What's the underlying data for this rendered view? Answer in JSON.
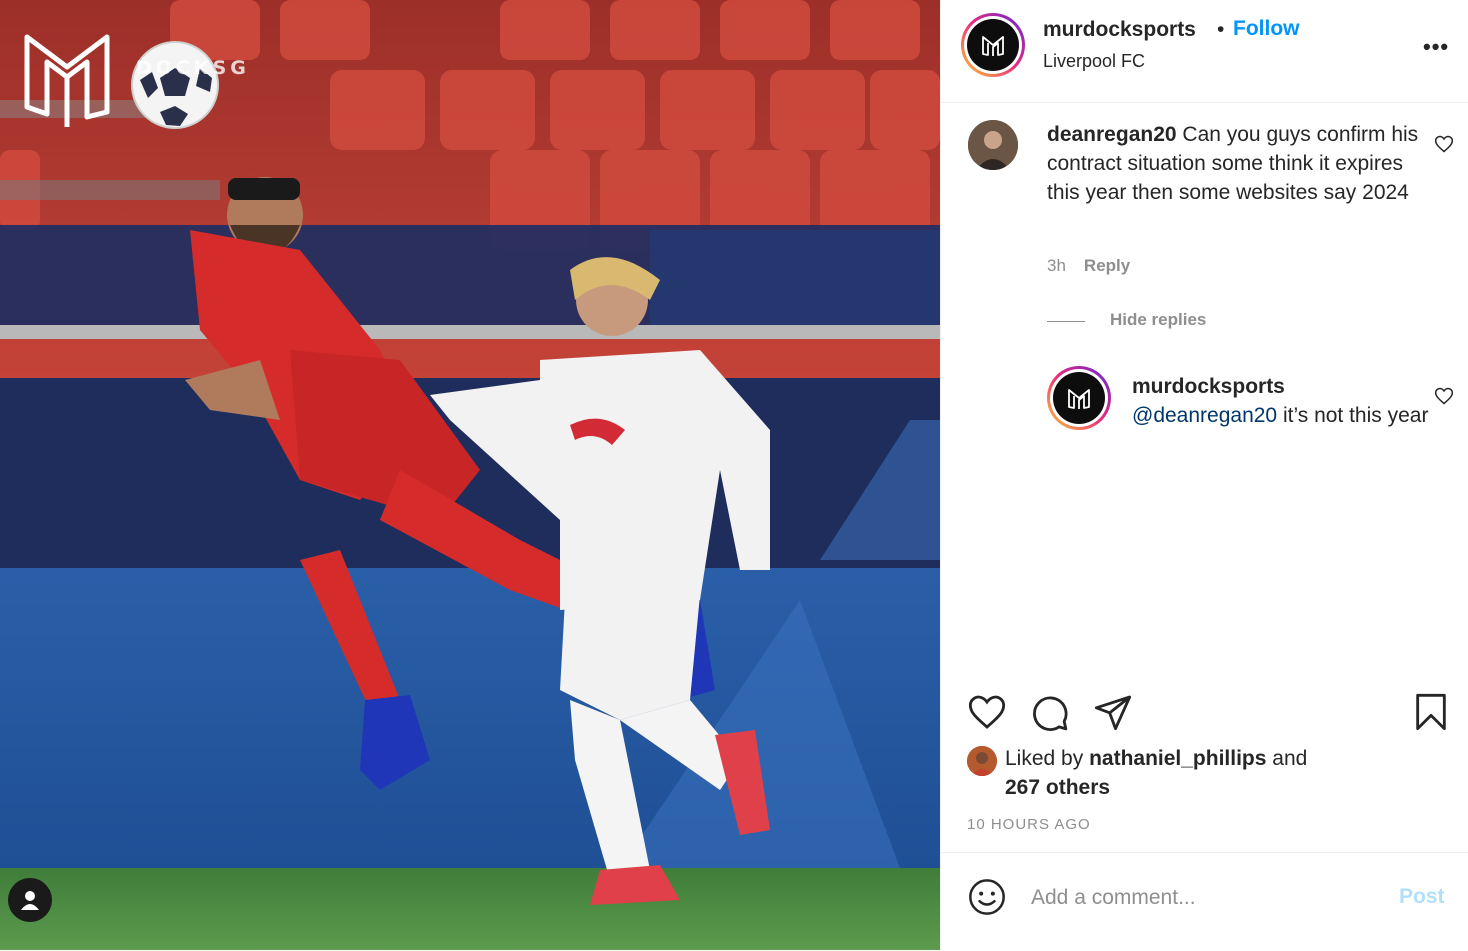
{
  "photo": {
    "watermark_text": "DOCKSG",
    "logo_icon": "murdock-m-logo-icon",
    "ball_icon": "football-icon",
    "tag_icon": "user-tag-icon"
  },
  "header": {
    "username": "murdocksports",
    "separator": "•",
    "follow_label": "Follow",
    "location": "Liverpool FC",
    "more_label": "•••"
  },
  "comment": {
    "username": "deanregan20",
    "text": " Can you guys confirm his contract situation some think it expires this year then some websites say 2024",
    "time": "3h",
    "reply_label": "Reply"
  },
  "hide_replies_label": "Hide replies",
  "reply": {
    "username": "murdocksports",
    "mention": "@deanregan20",
    "text": " it’s not this year"
  },
  "likes": {
    "prefix": "Liked by ",
    "liker": "nathaniel_phillips",
    "suffix": " and ",
    "others": "267 others"
  },
  "timestamp": "10 HOURS AGO",
  "comment_box": {
    "placeholder": "Add a comment...",
    "post_label": "Post"
  },
  "colors": {
    "accent": "#0095f6",
    "post_disabled": "#b2dffc",
    "muted": "#8e8e8e"
  }
}
